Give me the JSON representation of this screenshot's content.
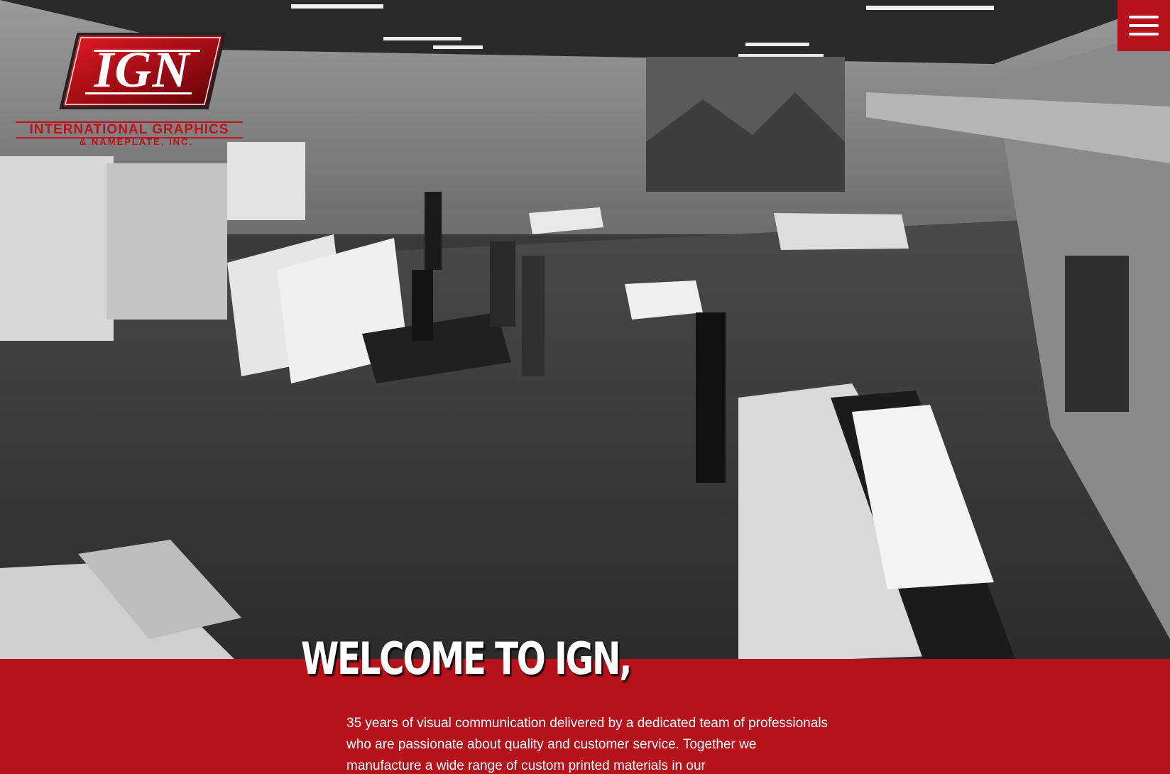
{
  "logo": {
    "mark": "IGN",
    "line1": "INTERNATIONAL GRAPHICS",
    "line2": "& NAMEPLATE, INC."
  },
  "menu": {
    "icon": "hamburger-menu-icon"
  },
  "hero": {
    "image": "grayscale-warehouse-print-shop-photo"
  },
  "welcome": {
    "title": "WELCOME TO IGN,",
    "body": "35 years of visual communication delivered by a dedicated team of professionals who are passionate about quality and customer service. Together we manufacture a wide range of custom printed materials in our"
  },
  "colors": {
    "brand_red": "#b5121b",
    "text_white": "#ffffff"
  }
}
